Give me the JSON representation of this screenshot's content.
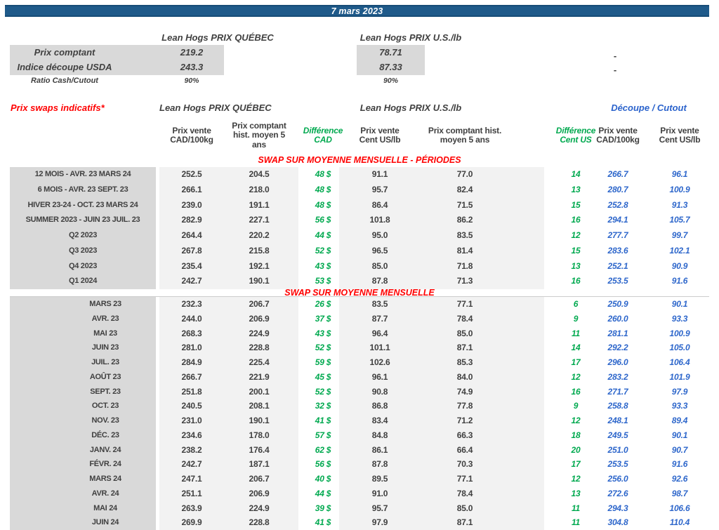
{
  "title_bar": {
    "date": "7 mars 2023"
  },
  "colors": {
    "title_bar_bg": "#1F5A8A",
    "label_block_gray": "#D9D9D9",
    "value_band_gray": "#F2F2F2",
    "text_dark": "#404040",
    "difference_green": "#00A94F",
    "cutout_blue": "#2E67CB",
    "section_red": "#FF0000"
  },
  "spot": {
    "qc_header": "Lean Hogs PRIX QUÉBEC",
    "us_header": "Lean Hogs PRIX U.S./lb",
    "rows": [
      {
        "label": "Prix comptant",
        "qc": "219.2",
        "us": "78.71",
        "right": "-"
      },
      {
        "label": "Indice découpe USDA",
        "qc": "243.3",
        "us": "87.33",
        "right": "-"
      },
      {
        "label": "Ratio Cash/Cutout",
        "qc": "90%",
        "us": "90%",
        "right": ""
      }
    ]
  },
  "swaps": {
    "title": "Prix swaps indicatifs*",
    "qc_header": "Lean Hogs PRIX QUÉBEC",
    "us_header": "Lean Hogs PRIX U.S./lb",
    "cutout_header": "Découpe / Cutout",
    "columns": [
      "Prix vente\nCAD/100kg",
      "Prix comptant\nhist. moyen 5\nans",
      "Différence\nCAD",
      "Prix vente\nCent US/lb",
      "Prix comptant hist.\nmoyen 5 ans",
      "Différence\nCent US",
      "Prix vente\nCAD/100kg",
      "Prix vente\nCent US/lb"
    ],
    "sections": [
      {
        "header": "SWAP SUR MOYENNE MENSUELLE - PÉRIODES",
        "rows": [
          {
            "label": "12 MOIS - AVR. 23 MARS 24",
            "values": [
              "252.5",
              "204.5",
              "48 $",
              "91.1",
              "77.0",
              "14",
              "266.7",
              "96.1"
            ]
          },
          {
            "label": "6 MOIS - AVR. 23 SEPT. 23",
            "values": [
              "266.1",
              "218.0",
              "48 $",
              "95.7",
              "82.4",
              "13",
              "280.7",
              "100.9"
            ]
          },
          {
            "label": "HIVER 23-24 -  OCT. 23 MARS 24",
            "values": [
              "239.0",
              "191.1",
              "48 $",
              "86.4",
              "71.5",
              "15",
              "252.8",
              "91.3"
            ]
          },
          {
            "label": "SUMMER 2023 - JUIN 23 JUIL. 23",
            "values": [
              "282.9",
              "227.1",
              "56 $",
              "101.8",
              "86.2",
              "16",
              "294.1",
              "105.7"
            ]
          },
          {
            "label": "Q2 2023",
            "values": [
              "264.4",
              "220.2",
              "44 $",
              "95.0",
              "83.5",
              "12",
              "277.7",
              "99.7"
            ]
          },
          {
            "label": "Q3 2023",
            "values": [
              "267.8",
              "215.8",
              "52 $",
              "96.5",
              "81.4",
              "15",
              "283.6",
              "102.1"
            ]
          },
          {
            "label": "Q4 2023",
            "values": [
              "235.4",
              "192.1",
              "43 $",
              "85.0",
              "71.8",
              "13",
              "252.1",
              "90.9"
            ]
          },
          {
            "label": "Q1 2024",
            "values": [
              "242.7",
              "190.1",
              "53 $",
              "87.8",
              "71.3",
              "16",
              "253.5",
              "91.6"
            ]
          }
        ]
      },
      {
        "header": "SWAP SUR MOYENNE MENSUELLE",
        "rows": [
          {
            "label": "MARS 23",
            "values": [
              "232.3",
              "206.7",
              "26 $",
              "83.5",
              "77.1",
              "6",
              "250.9",
              "90.1"
            ]
          },
          {
            "label": "AVR. 23",
            "values": [
              "244.0",
              "206.9",
              "37 $",
              "87.7",
              "78.4",
              "9",
              "260.0",
              "93.3"
            ]
          },
          {
            "label": "MAI 23",
            "values": [
              "268.3",
              "224.9",
              "43 $",
              "96.4",
              "85.0",
              "11",
              "281.1",
              "100.9"
            ]
          },
          {
            "label": "JUIN 23",
            "values": [
              "281.0",
              "228.8",
              "52 $",
              "101.1",
              "87.1",
              "14",
              "292.2",
              "105.0"
            ]
          },
          {
            "label": "JUIL. 23",
            "values": [
              "284.9",
              "225.4",
              "59 $",
              "102.6",
              "85.3",
              "17",
              "296.0",
              "106.4"
            ]
          },
          {
            "label": "AOÛT 23",
            "values": [
              "266.7",
              "221.9",
              "45 $",
              "96.1",
              "84.0",
              "12",
              "283.2",
              "101.9"
            ]
          },
          {
            "label": "SEPT. 23",
            "values": [
              "251.8",
              "200.1",
              "52 $",
              "90.8",
              "74.9",
              "16",
              "271.7",
              "97.9"
            ]
          },
          {
            "label": "OCT. 23",
            "values": [
              "240.5",
              "208.1",
              "32 $",
              "86.8",
              "77.8",
              "9",
              "258.8",
              "93.3"
            ]
          },
          {
            "label": "NOV. 23",
            "values": [
              "231.0",
              "190.1",
              "41 $",
              "83.4",
              "71.2",
              "12",
              "248.1",
              "89.4"
            ]
          },
          {
            "label": "DÉC. 23",
            "values": [
              "234.6",
              "178.0",
              "57 $",
              "84.8",
              "66.3",
              "18",
              "249.5",
              "90.1"
            ]
          },
          {
            "label": "JANV. 24",
            "values": [
              "238.2",
              "176.4",
              "62 $",
              "86.1",
              "66.4",
              "20",
              "251.0",
              "90.7"
            ]
          },
          {
            "label": "FÉVR. 24",
            "values": [
              "242.7",
              "187.1",
              "56 $",
              "87.8",
              "70.3",
              "17",
              "253.5",
              "91.6"
            ]
          },
          {
            "label": "MARS 24",
            "values": [
              "247.1",
              "206.7",
              "40 $",
              "89.5",
              "77.1",
              "12",
              "256.0",
              "92.6"
            ]
          },
          {
            "label": "AVR. 24",
            "values": [
              "251.1",
              "206.9",
              "44 $",
              "91.0",
              "78.4",
              "13",
              "272.6",
              "98.7"
            ]
          },
          {
            "label": "MAI 24",
            "values": [
              "263.9",
              "224.9",
              "39 $",
              "95.7",
              "85.0",
              "11",
              "294.3",
              "106.6"
            ]
          },
          {
            "label": "JUIN 24",
            "values": [
              "269.9",
              "228.8",
              "41 $",
              "97.9",
              "87.1",
              "11",
              "304.8",
              "110.4"
            ]
          }
        ]
      }
    ]
  }
}
